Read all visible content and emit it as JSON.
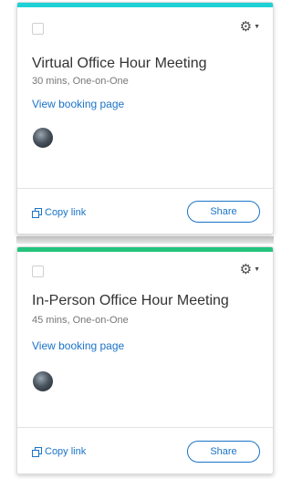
{
  "cards": [
    {
      "accent_color": "#1ed1d6",
      "title": "Virtual Office Hour Meeting",
      "subtitle": "30 mins, One-on-One",
      "view_link": "View booking page",
      "copy_link": "Copy link",
      "share_label": "Share",
      "gear_icon": "gear-icon",
      "avatar_icon": "avatar"
    },
    {
      "accent_color": "#24c47d",
      "title": "In-Person Office Hour Meeting",
      "subtitle": "45 mins, One-on-One",
      "view_link": "View booking page",
      "copy_link": "Copy link",
      "share_label": "Share",
      "gear_icon": "gear-icon",
      "avatar_icon": "avatar"
    }
  ],
  "colors": {
    "link": "#1a73c8",
    "title": "#333333",
    "subtitle": "#777777"
  }
}
